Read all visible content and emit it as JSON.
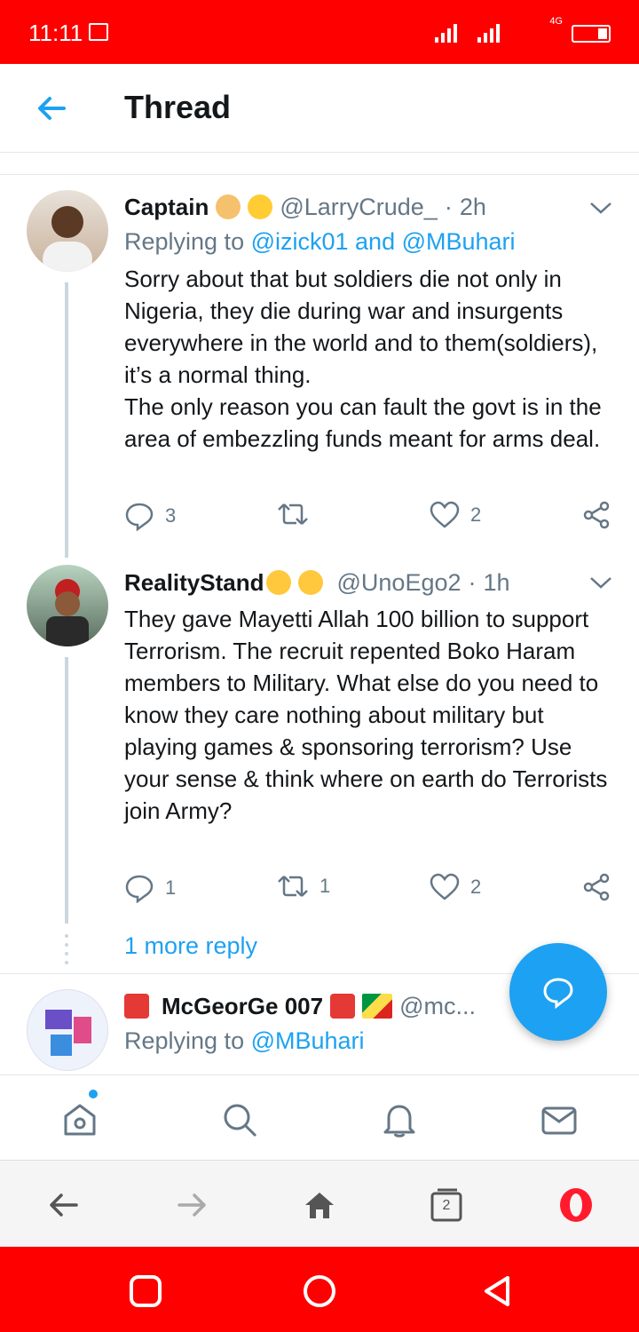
{
  "status": {
    "time": "11:11",
    "network": "4G"
  },
  "header": {
    "title": "Thread"
  },
  "tweets": [
    {
      "name": "Captain",
      "handle": "@LarryCrude_",
      "dot": "·",
      "time": "2h",
      "replying_prefix": "Replying to ",
      "replying_to": "@izick01 and @MBuhari",
      "text": "Sorry about that but soldiers die not only in Nigeria, they die during war and insurgents everywhere in the world and to them(soldiers), it’s a normal thing.\nThe only reason you can fault the govt is in the area of embezzling funds meant for arms deal.",
      "replies": "3",
      "retweets": "",
      "likes": "2"
    },
    {
      "name": "RealityStand",
      "handle": "@UnoEgo2",
      "dot": "·",
      "time": "1h",
      "text": "They gave Mayetti Allah 100 billion to support Terrorism. The recruit repented Boko Haram members to Military. What else do you need to know they care nothing about military but playing games & sponsoring terrorism? Use your sense & think where on earth do Terrorists join Army?",
      "replies": "1",
      "retweets": "1",
      "likes": "2"
    },
    {
      "name": "McGeorGe 007",
      "handle": "@mc...",
      "replying_prefix": "Replying to ",
      "replying_to": "@MBuhari"
    }
  ],
  "more_reply": "1 more reply",
  "browser": {
    "tab_count": "2"
  },
  "colors": {
    "accent": "#1da1f2",
    "statusbar": "#ff0000",
    "muted": "#657786"
  }
}
